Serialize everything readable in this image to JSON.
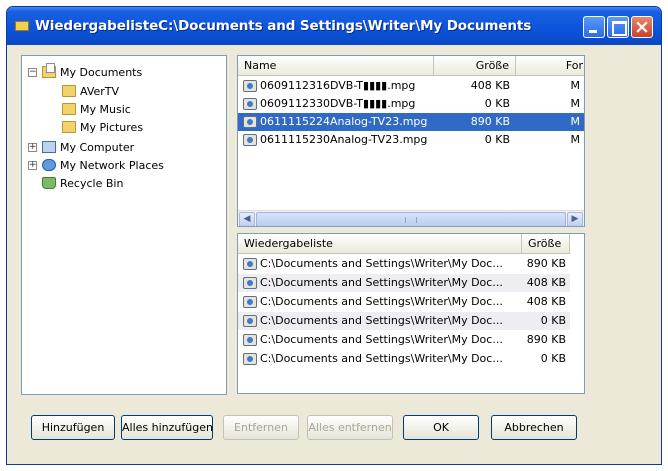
{
  "window": {
    "title": "WiedergabelisteC:\\Documents and Settings\\Writer\\My Documents"
  },
  "tree": {
    "items": [
      {
        "label": "My Documents",
        "icon": "doc-folder-icon",
        "expander": "−"
      },
      {
        "label": "AVerTV",
        "icon": "folder-icon"
      },
      {
        "label": "My Music",
        "icon": "music-folder-icon"
      },
      {
        "label": "My Pictures",
        "icon": "pictures-folder-icon"
      },
      {
        "label": "My Computer",
        "icon": "computer-icon",
        "expander": "+"
      },
      {
        "label": "My Network Places",
        "icon": "network-icon",
        "expander": "+"
      },
      {
        "label": "Recycle Bin",
        "icon": "recycle-bin-icon"
      }
    ]
  },
  "files": {
    "columns": [
      "Name",
      "Größe",
      "For"
    ],
    "rows": [
      {
        "name": "0609112316DVB-T▮▮▮▮.mpg",
        "size": "408 KB",
        "format": "M",
        "selected": false
      },
      {
        "name": "0609112330DVB-T▮▮▮▮.mpg",
        "size": "0 KB",
        "format": "M",
        "selected": false
      },
      {
        "name": "0611115224Analog-TV23.mpg",
        "size": "890 KB",
        "format": "M",
        "selected": true
      },
      {
        "name": "0611115230Analog-TV23.mpg",
        "size": "0 KB",
        "format": "M",
        "selected": false
      }
    ],
    "scroll_grip": "|||"
  },
  "playlist": {
    "columns": [
      "Wiedergabeliste",
      "Größe"
    ],
    "rows": [
      {
        "path": "C:\\Documents and Settings\\Writer\\My Doc...",
        "size": "890 KB"
      },
      {
        "path": "C:\\Documents and Settings\\Writer\\My Doc...",
        "size": "408 KB"
      },
      {
        "path": "C:\\Documents and Settings\\Writer\\My Doc...",
        "size": "408 KB"
      },
      {
        "path": "C:\\Documents and Settings\\Writer\\My Doc...",
        "size": "0 KB"
      },
      {
        "path": "C:\\Documents and Settings\\Writer\\My Doc...",
        "size": "890 KB"
      },
      {
        "path": "C:\\Documents and Settings\\Writer\\My Doc...",
        "size": "0 KB"
      }
    ]
  },
  "buttons": {
    "add": "Hinzufügen",
    "add_all": "Alles hinzufügen",
    "remove": "Entfernen",
    "remove_all": "Alles entfernen",
    "ok": "OK",
    "cancel": "Abbrechen"
  },
  "colors": {
    "selection": "#316ac5",
    "titlebar": "#0b55dd",
    "dialog_bg": "#ece9d8"
  }
}
